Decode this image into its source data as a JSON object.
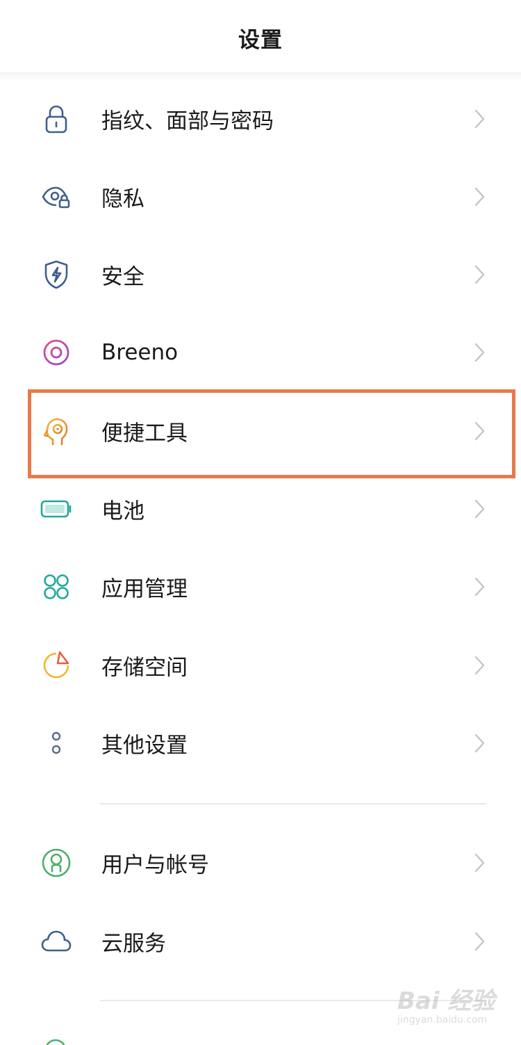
{
  "header": {
    "title": "设置"
  },
  "items": [
    {
      "label": "指纹、面部与密码",
      "icon": "lock-icon",
      "color": "#3f5f8a"
    },
    {
      "label": "隐私",
      "icon": "privacy-eye-icon",
      "color": "#3f5f8a"
    },
    {
      "label": "安全",
      "icon": "shield-bolt-icon",
      "color": "#3f5f8a"
    },
    {
      "label": "Breeno",
      "icon": "breeno-ring-icon",
      "color": "#c049a8"
    },
    {
      "label": "便捷工具",
      "icon": "head-tool-icon",
      "color": "#e0a22a",
      "highlighted": true
    },
    {
      "label": "电池",
      "icon": "battery-icon",
      "color": "#1fa99a"
    },
    {
      "label": "应用管理",
      "icon": "app-grid-icon",
      "color": "#1fa99a"
    },
    {
      "label": "存储空间",
      "icon": "storage-pie-icon",
      "color": "#f0b82a"
    },
    {
      "label": "其他设置",
      "icon": "more-dots-icon",
      "color": "#5a6b85"
    },
    {
      "label": "用户与帐号",
      "icon": "user-icon",
      "color": "#4caf6a"
    },
    {
      "label": "云服务",
      "icon": "cloud-icon",
      "color": "#3f5f8a"
    }
  ],
  "highlight_color": "#e8794a",
  "watermark": {
    "logo": "Bai 经验",
    "url": "jingyan.baidu.com"
  }
}
